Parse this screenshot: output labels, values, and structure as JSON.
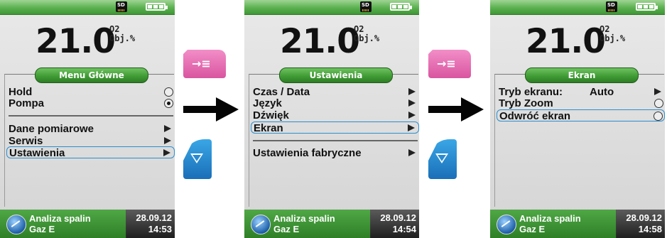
{
  "screens": [
    {
      "status": {
        "sd_label": "SD"
      },
      "reading": {
        "value": "21.0",
        "unit_line1": "O2",
        "unit_line2": "Obj.%"
      },
      "menu_title": "Menu Główne",
      "items": [
        {
          "label": "Hold",
          "control": "radio",
          "checked": false
        },
        {
          "label": "Pompa",
          "control": "radio",
          "checked": true
        },
        {
          "label": "Dane pomiarowe",
          "control": "arrow"
        },
        {
          "label": "Serwis",
          "control": "arrow"
        },
        {
          "label": "Ustawienia",
          "control": "arrow",
          "selected": true
        }
      ],
      "footer": {
        "line1": "Analiza spalin",
        "line2": "Gaz E",
        "date": "28.09.12",
        "time": "14:53"
      }
    },
    {
      "status": {
        "sd_label": "SD"
      },
      "reading": {
        "value": "21.0",
        "unit_line1": "O2",
        "unit_line2": "Obj.%"
      },
      "menu_title": "Ustawienia",
      "items": [
        {
          "label": "Czas / Data",
          "control": "arrow"
        },
        {
          "label": "Język",
          "control": "arrow"
        },
        {
          "label": "Dźwięk",
          "control": "arrow"
        },
        {
          "label": "Ekran",
          "control": "arrow",
          "selected": true
        },
        {
          "label": "Ustawienia fabryczne",
          "control": "arrow"
        }
      ],
      "footer": {
        "line1": "Analiza spalin",
        "line2": "Gaz E",
        "date": "28.09.12",
        "time": "14:54"
      }
    },
    {
      "status": {
        "sd_label": "SD"
      },
      "reading": {
        "value": "21.0",
        "unit_line1": "O2",
        "unit_line2": "Obj.%"
      },
      "menu_title": "Ekran",
      "items": [
        {
          "label": "Tryb ekranu:",
          "value": "Auto",
          "control": "arrow"
        },
        {
          "label": "Tryb Zoom",
          "control": "radio",
          "checked": false
        },
        {
          "label": "Odwróć ekran",
          "control": "radio",
          "checked": false,
          "selected": true
        }
      ],
      "footer": {
        "line1": "Analiza spalin",
        "line2": "Gaz E",
        "date": "28.09.12",
        "time": "14:58"
      }
    }
  ],
  "buttons": {
    "enter_glyph": "→≡",
    "down_icon": "triangle-down-icon"
  },
  "colors": {
    "status_green": "#5bb04f",
    "menu_green": "#3e9933",
    "pink_button": "#e46bb0",
    "blue_button": "#2a8bd2",
    "selection_blue": "#2a8ed0"
  }
}
